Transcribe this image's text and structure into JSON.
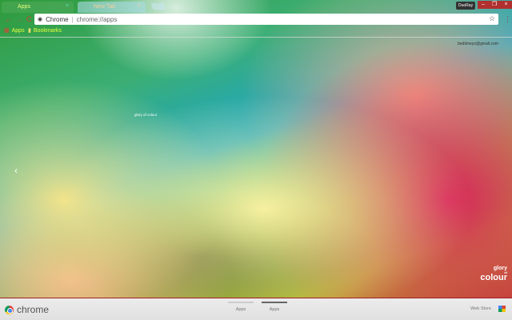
{
  "tabs": [
    {
      "label": "Apps",
      "close": "×"
    },
    {
      "label": "New Tab",
      "close": "×"
    }
  ],
  "user": "DuoRay",
  "window": {
    "minimize": "–",
    "restore": "❐",
    "close": "×"
  },
  "toolbar": {
    "back": "←",
    "forward": "→",
    "reload": "C",
    "site": "Chrome",
    "url": "chrome://apps",
    "star": "☆",
    "menu": "⋮"
  },
  "bookmarks": [
    {
      "label": "Apps"
    },
    {
      "label": "Bookmarks"
    }
  ],
  "wallpaper": {
    "email": "bedtimeyo@gmail.com",
    "caption": "glory of colour",
    "logo_top": "glory",
    "logo_of": "of",
    "logo_main": "colour"
  },
  "prev_arrow": "‹",
  "footer": {
    "brand": "chrome",
    "pages": [
      "Apps",
      "Apps"
    ],
    "webstore": "Web Store"
  }
}
